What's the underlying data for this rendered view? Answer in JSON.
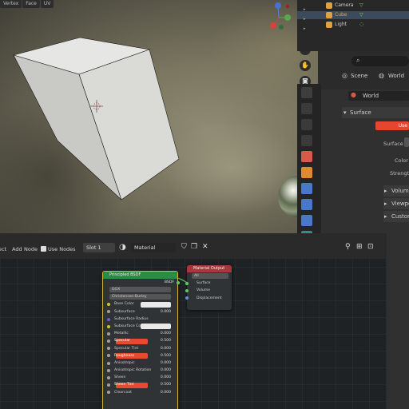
{
  "viewport": {
    "tabs": [
      "Vertex",
      "Face",
      "UV"
    ],
    "gizmo": {
      "z": "Z",
      "y": "Y",
      "x": "X"
    }
  },
  "outliner": {
    "items": [
      {
        "label": "Camera",
        "color": "#e0a240"
      },
      {
        "label": "Cube",
        "color": "#e0a240",
        "selected": true
      },
      {
        "label": "Light",
        "color": "#e0a240"
      }
    ]
  },
  "properties": {
    "scene_label": "Scene",
    "world_label": "World",
    "world_name": "World",
    "surface_panel": "Surface",
    "surface_field_label": "Surface",
    "surface_value": "Use",
    "color_label": "Color",
    "strength_label": "Strength",
    "volume_panel": "Volume",
    "viewport_panel": "Viewport",
    "custom_panel": "Custom"
  },
  "node_editor": {
    "menu": [
      "ect",
      "Add",
      "Node"
    ],
    "use_nodes_label": "Use Nodes",
    "slot": "Slot 1",
    "material": "Material",
    "principled": {
      "title": "Principled BSDF",
      "output": "BSDF",
      "distribution": "GGX",
      "subsurface_method": "Christensen-Burley",
      "rows": [
        {
          "label": "Base Color",
          "type": "white"
        },
        {
          "label": "Subsurface",
          "value": "0.000"
        },
        {
          "label": "Subsurface Radius",
          "type": "dark"
        },
        {
          "label": "Subsurface Color",
          "type": "white"
        },
        {
          "label": "Metallic",
          "value": "0.000"
        },
        {
          "label": "Specular",
          "type": "red",
          "value": "0.500"
        },
        {
          "label": "Specular Tint",
          "value": "0.000"
        },
        {
          "label": "Roughness",
          "type": "red",
          "value": "0.500"
        },
        {
          "label": "Anisotropic",
          "value": "0.000"
        },
        {
          "label": "Anisotropic Rotation",
          "value": "0.000"
        },
        {
          "label": "Sheen",
          "value": "0.000"
        },
        {
          "label": "Sheen Tint",
          "type": "red",
          "value": "0.500"
        },
        {
          "label": "Clearcoat",
          "value": "0.000"
        }
      ]
    },
    "output_node": {
      "title": "Material Output",
      "target": "All",
      "sockets": [
        "Surface",
        "Volume",
        "Displacement"
      ]
    }
  },
  "colors": {
    "accent_red": "#e84a31",
    "node_green": "#2e8b44",
    "output_red": "#a8363a",
    "socket_green": "#63c763",
    "socket_yellow": "#c7c729",
    "socket_purple": "#6363c7",
    "socket_gray": "#a1a1a1",
    "socket_blue": "#6d8bd9"
  }
}
